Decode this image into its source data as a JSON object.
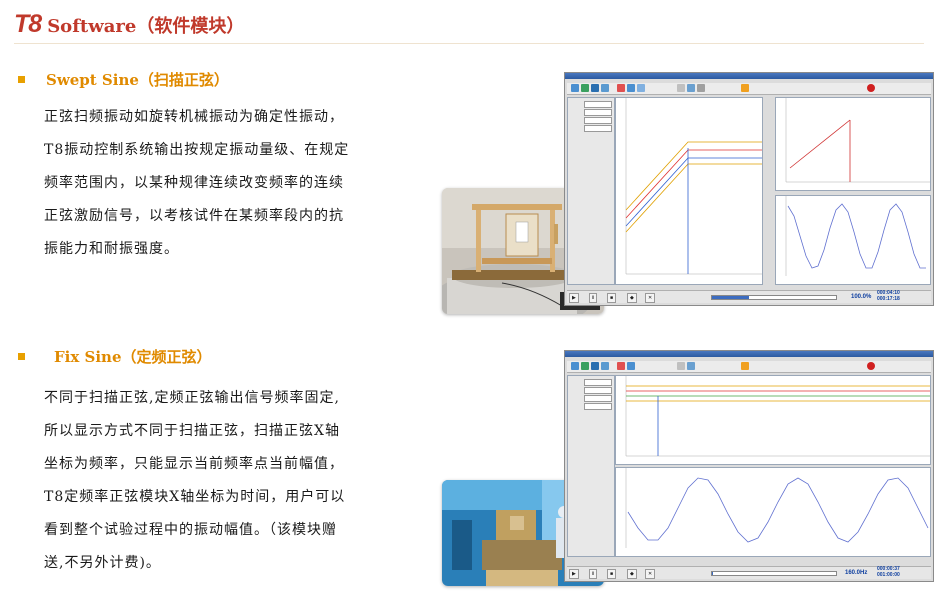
{
  "header": {
    "brand": "T8",
    "title": "Software（软件模块）"
  },
  "sections": [
    {
      "heading": "Swept Sine（扫描正弦）",
      "lines": [
        "正弦扫频振动如旋转机械振动为确定性振动，",
        "T8振动控制系统输出按规定振动量级、在规定",
        "频率范围内，以某种规律连续改变频率的连续",
        "正弦激励信号，以考核试件在某频率段内的抗",
        "振能力和耐振强度。"
      ],
      "screen": {
        "zoom": "100.0%",
        "time1": "000:04:10",
        "time2": "000:17:18"
      }
    },
    {
      "heading": "Fix Sine（定频正弦）",
      "lines": [
        "不同于扫描正弦,定频正弦输出信号频率固定,",
        "所以显示方式不同于扫描正弦，扫描正弦X轴",
        "坐标为频率，只能显示当前频率点当前幅值，",
        "T8定频率正弦模块X轴坐标为时间，用户可以",
        "看到整个试验过程中的振动幅值。（该模块赠",
        "送,不另外计费)。"
      ],
      "screen": {
        "freq": "160.0Hz",
        "time1": "000:00:37",
        "time2": "001:00:00"
      }
    }
  ],
  "colors": {
    "accent": "#c0392b",
    "heading": "#e08a00",
    "bullet": "#e8a000"
  }
}
